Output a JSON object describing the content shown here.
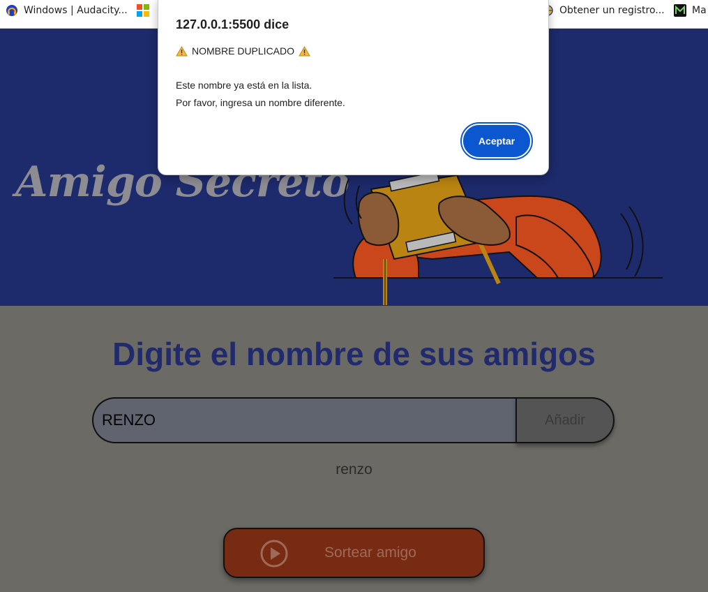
{
  "bookmarks": [
    {
      "label": "Windows | Audacity...",
      "icon": "audacity-icon"
    },
    {
      "label": "",
      "icon": "microsoft-icon"
    },
    {
      "label": "Obtener un registro...",
      "icon": "globe-icon"
    },
    {
      "label": "Ma",
      "icon": "m-logo-icon"
    }
  ],
  "hero": {
    "title": "Amigo Secreto"
  },
  "main": {
    "heading": "Digite el nombre de sus amigos",
    "input_value": "RENZO",
    "add_label": "Añadir",
    "friends": [
      "renzo"
    ],
    "draw_label": "Sortear amigo"
  },
  "dialog": {
    "origin": "127.0.0.1:5500 dice",
    "heading": "NOMBRE DUPLICADO",
    "line1": "Este nombre ya está en la lista.",
    "line2": "Por favor, ingresa un nombre diferente.",
    "accept_label": "Aceptar"
  },
  "colors": {
    "hero_bg": "#1d2a6b",
    "page_bg": "#6b6a64",
    "heading": "#202a6c",
    "accept": "#0b57d0",
    "draw_button": "#762b12"
  }
}
